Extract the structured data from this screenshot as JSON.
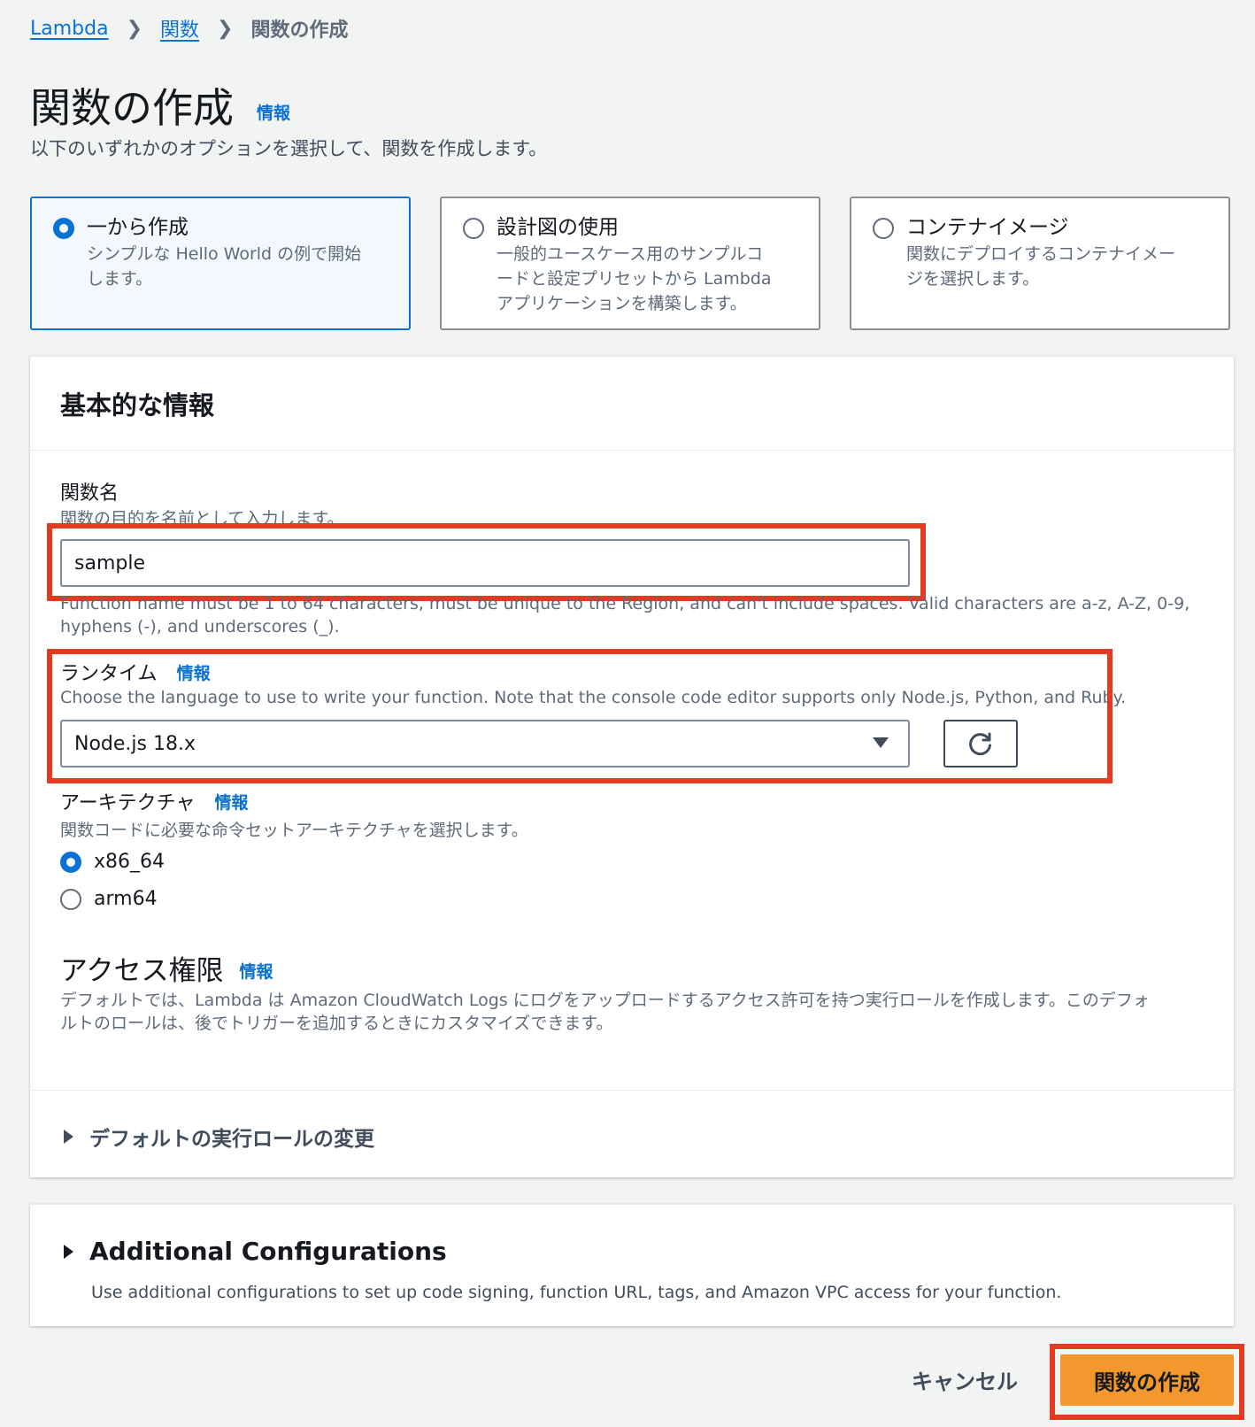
{
  "breadcrumb": {
    "items": [
      "Lambda",
      "関数"
    ],
    "current": "関数の作成"
  },
  "page": {
    "title": "関数の作成",
    "info": "情報",
    "description": "以下のいずれかのオプションを選択して、関数を作成します。"
  },
  "options": [
    {
      "title": "一から作成",
      "desc_lines": [
        "シンプルな Hello World の例で開始",
        "します。"
      ],
      "selected": true
    },
    {
      "title": "設計図の使用",
      "desc_lines": [
        "一般的ユースケース用のサンプルコ",
        "ードと設定プリセットから Lambda",
        "アプリケーションを構築します。"
      ],
      "selected": false
    },
    {
      "title": "コンテナイメージ",
      "desc_lines": [
        "関数にデプロイするコンテナイメー",
        "ジを選択します。"
      ],
      "selected": false
    }
  ],
  "basic_info": {
    "title": "基本的な情報",
    "function_name": {
      "label": "関数名",
      "desc": "関数の目的を名前として入力します。",
      "value": "sample",
      "constraint_lines": [
        "Function name must be 1 to 64 characters, must be unique to the Region, and can't include spaces. Valid characters are a-z, A-Z, 0-9,",
        "hyphens (-), and underscores (_)."
      ]
    },
    "runtime": {
      "label": "ランタイム",
      "info": "情報",
      "desc": "Choose the language to use to write your function. Note that the console code editor supports only Node.js, Python, and Ruby.",
      "value": "Node.js 18.x"
    },
    "architecture": {
      "label": "アーキテクチャ",
      "info": "情報",
      "desc": "関数コードに必要な命令セットアーキテクチャを選択します。",
      "options": [
        "x86_64",
        "arm64"
      ],
      "selected": "x86_64"
    },
    "permissions": {
      "title": "アクセス権限",
      "info": "情報",
      "desc_lines": [
        "デフォルトでは、Lambda は Amazon CloudWatch Logs にログをアップロードするアクセス許可を持つ実行ロールを作成します。このデフォ",
        "ルトのロールは、後でトリガーを追加するときにカスタマイズできます。"
      ],
      "expander": "デフォルトの実行ロールの変更"
    }
  },
  "additional": {
    "title": "Additional Configurations",
    "desc": "Use additional configurations to set up code signing, function URL, tags, and Amazon VPC access for your function."
  },
  "footer": {
    "cancel": "キャンセル",
    "submit": "関数の作成"
  },
  "colors": {
    "link": "#0972d3",
    "primary": "#f2982d",
    "highlight": "#e33a22"
  }
}
